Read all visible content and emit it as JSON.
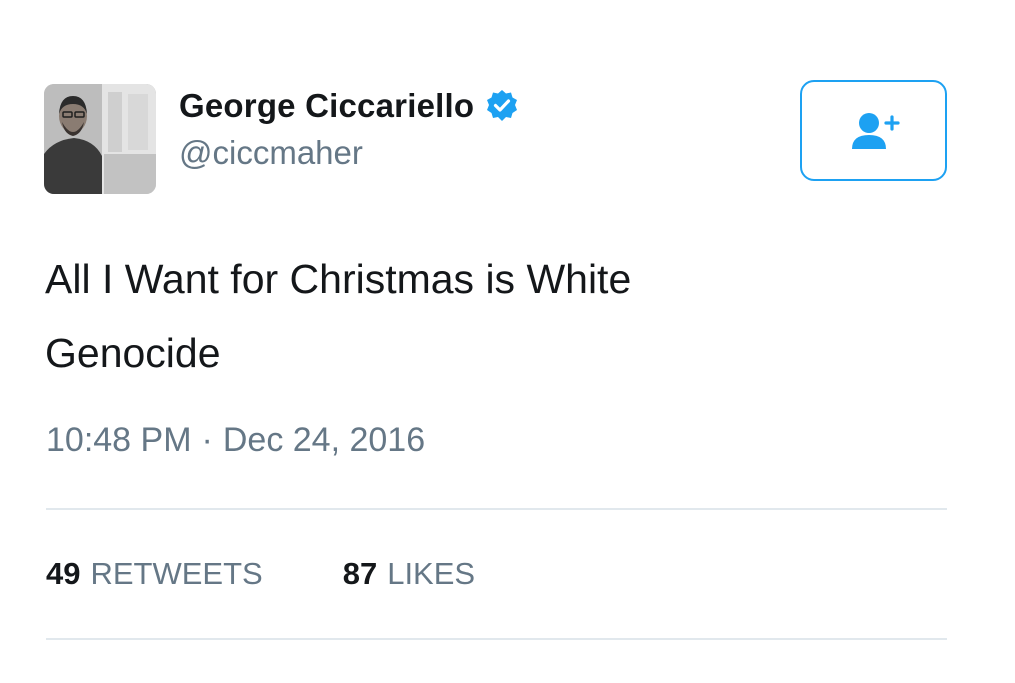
{
  "author": {
    "name": "George Ciccariello",
    "handle": "@ciccmaher",
    "verified": true
  },
  "tweet": {
    "text": "All I Want for Christmas is White Genocide",
    "time": "10:48 PM",
    "separator": "·",
    "date": "Dec 24, 2016"
  },
  "stats": {
    "retweets_count": "49",
    "retweets_label": "RETWEETS",
    "likes_count": "87",
    "likes_label": "LIKES"
  },
  "icons": {
    "verified": "verified-badge-icon",
    "follow": "add-user-icon"
  },
  "colors": {
    "accent": "#1da1f2",
    "text": "#14171a",
    "secondary": "#657786",
    "divider": "#e1e8ed"
  }
}
